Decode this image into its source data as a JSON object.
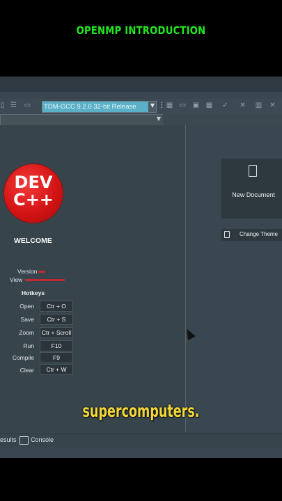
{
  "video_title": "OPENMP INTRODUCTION",
  "toolbar": {
    "compiler_selected": "TDM-GCC 9.2.0 32-bit Release"
  },
  "welcome": {
    "logo_top": "DEV",
    "logo_bottom": "C++",
    "heading": "WELCOME",
    "version_label": "Version",
    "view_label": "View",
    "hotkeys_title": "Hotkeys",
    "hotkeys": [
      {
        "action": "Open",
        "keys": "Ctr + O"
      },
      {
        "action": "Save",
        "keys": "Ctr + S"
      },
      {
        "action": "Zoom",
        "keys": "Ctr + Scroll"
      },
      {
        "action": "Run",
        "keys": "F10"
      },
      {
        "action": "Compile",
        "keys": "F9"
      },
      {
        "action": "Clear",
        "keys": "Ctr + W"
      }
    ]
  },
  "side_panel": {
    "new_document_label": "New Document",
    "change_theme_label": "Change Theme"
  },
  "bottom_bar": {
    "results_label": "esults",
    "console_label": "Console"
  },
  "caption": "supercomputers.",
  "colors": {
    "title_green": "#22e81f",
    "caption_yellow": "#f3d83a",
    "logo_red": "#d41414",
    "selection_cyan": "#5ab0c6"
  }
}
